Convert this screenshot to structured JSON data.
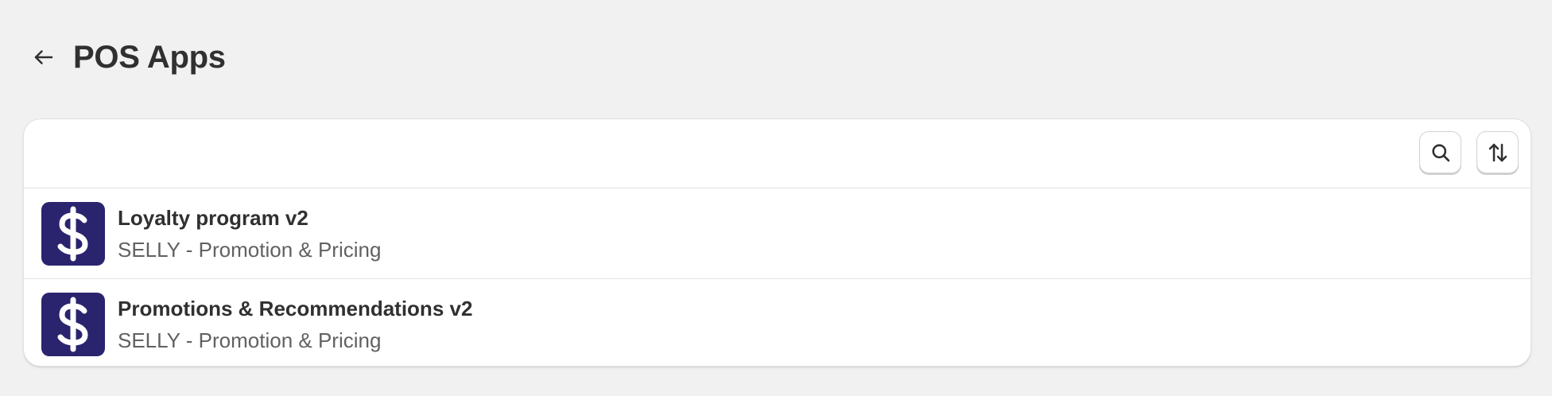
{
  "header": {
    "title": "POS Apps",
    "back_icon": "arrow-left-icon"
  },
  "toolbar": {
    "search_icon": "search-icon",
    "sort_icon": "sort-arrows-icon"
  },
  "apps": [
    {
      "name": "Loyalty program v2",
      "provider": "SELLY - Promotion & Pricing",
      "icon": "dollar-sign-icon"
    },
    {
      "name": "Promotions & Recommendations v2",
      "provider": "SELLY - Promotion & Pricing",
      "icon": "dollar-sign-icon"
    }
  ],
  "colors": {
    "background": "#f1f1f1",
    "card": "#ffffff",
    "app_icon_bg": "#2a246f",
    "text_primary": "#303030",
    "text_secondary": "#616161"
  }
}
